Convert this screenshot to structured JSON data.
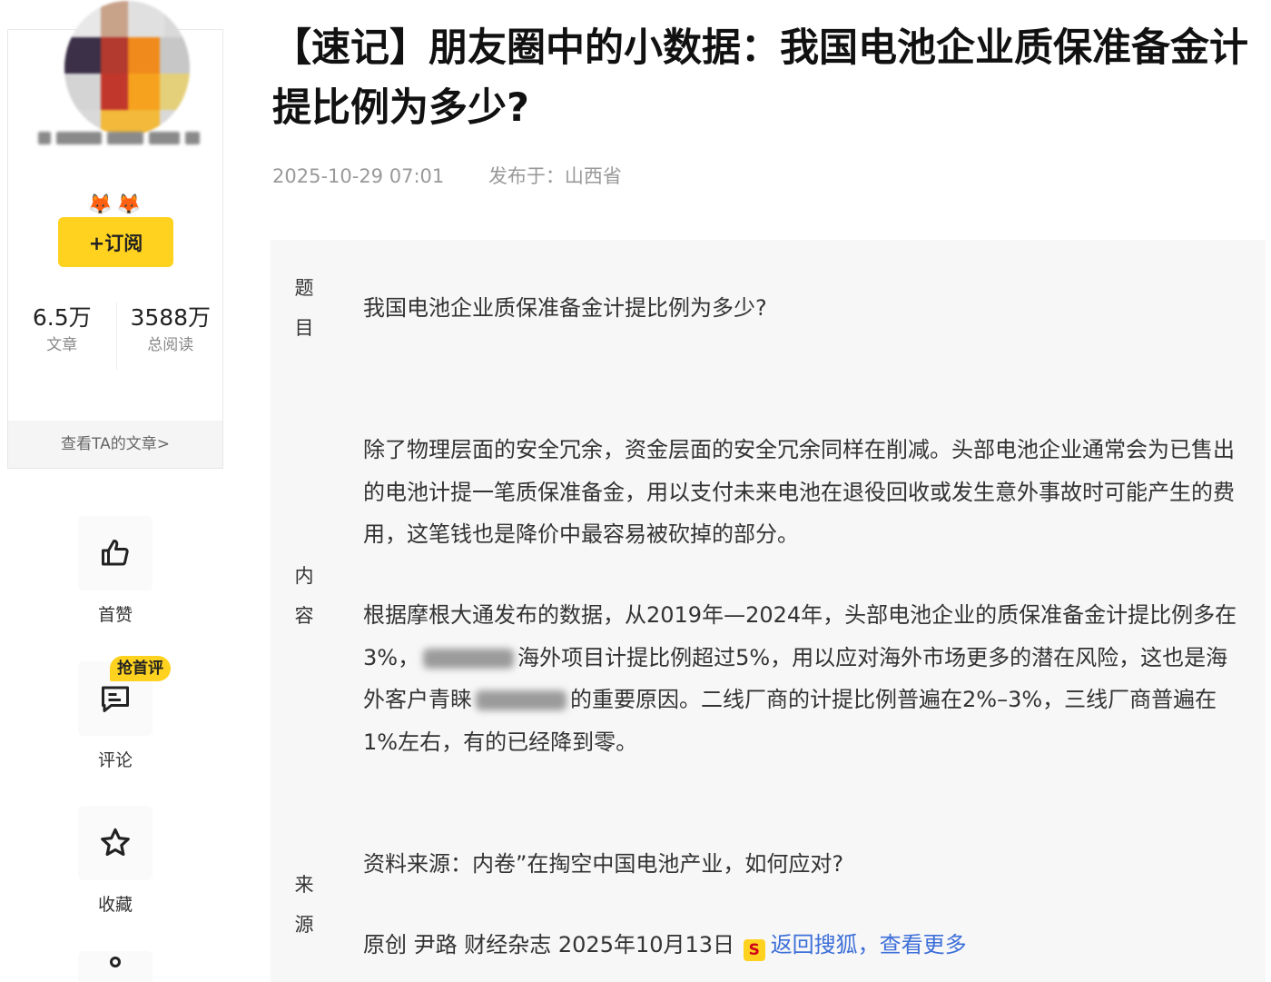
{
  "author": {
    "badges": "🦊🦊",
    "subscribe_label": "+订阅",
    "stats": [
      {
        "value": "6.5万",
        "label": "文章"
      },
      {
        "value": "3588万",
        "label": "总阅读"
      }
    ],
    "view_articles": "查看TA的文章>"
  },
  "actions": {
    "like": {
      "label": "首赞"
    },
    "comment": {
      "label": "评论",
      "badge": "抢首评"
    },
    "favorite": {
      "label": "收藏"
    }
  },
  "article": {
    "title": "【速记】朋友圈中的小数据：我国电池企业质保准备金计提比例为多少?",
    "date": "2025-10-29 07:01",
    "location": "发布于：山西省",
    "labels": {
      "topic": [
        "题",
        "目"
      ],
      "content": [
        "内",
        "容"
      ],
      "source": [
        "来",
        "源"
      ]
    },
    "question": "我国电池企业质保准备金计提比例为多少?",
    "paragraph1": "除了物理层面的安全冗余，资金层面的安全冗余同样在削减。头部电池企业通常会为已售出的电池计提一笔质保准备金，用以支付未来电池在退役回收或发生意外事故时可能产生的费用，这笔钱也是降价中最容易被砍掉的部分。",
    "paragraph2": {
      "part1": "根据摩根大通发布的数据，从2019年—2024年，头部电池企业的质保准备金计提比例多在3%，",
      "part2": "海外项目计提比例超过5%，用以应对海外市场更多的潜在风险，这也是海外客户青睐",
      "part3": "的重要原因。二线厂商的计提比例普遍在2%–3%，三线厂商普遍在1%左右，有的已经降到零。"
    },
    "source_line": "资料来源：内卷”在掏空中国电池产业，如何应对?",
    "credit": "原创 尹路 财经杂志 2025年10月13日",
    "source_icon": "S",
    "back_link": "返回搜狐，查看更多"
  },
  "colors": {
    "accent_yellow": "#ffd21f",
    "link_blue": "#3d6fd9",
    "panel_bg": "#f7f7f7"
  }
}
